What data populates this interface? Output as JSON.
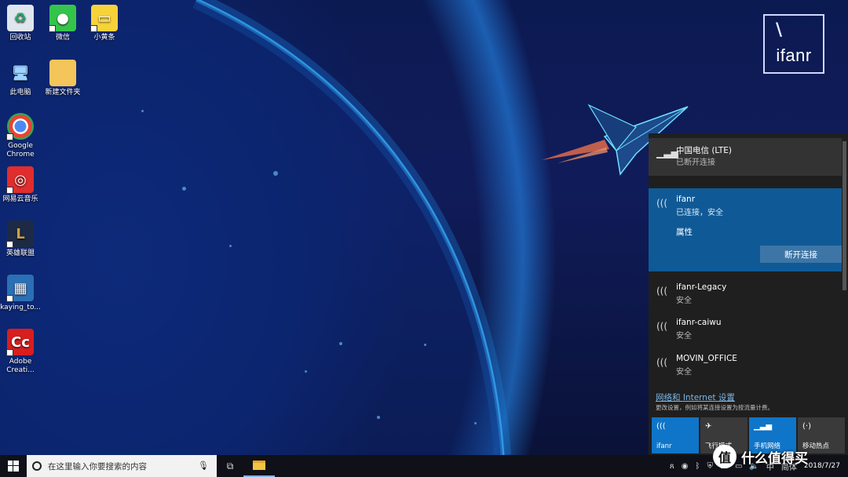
{
  "desktop": {
    "icons": [
      {
        "label": "回收站",
        "icon": "recycle-bin-icon",
        "color": "#dfe6ee"
      },
      {
        "label": "微信",
        "icon": "wechat-icon",
        "color": "#35c44b"
      },
      {
        "label": "小黄条",
        "icon": "sticky-note-icon",
        "color": "#f7d33a"
      },
      {
        "label": "此电脑",
        "icon": "computer-icon",
        "color": "#3a8ee6"
      },
      {
        "label": "新建文件夹",
        "icon": "folder-icon",
        "color": "#f3c55a"
      },
      {
        "label": "Google Chrome",
        "icon": "chrome-icon",
        "color": "#e84435"
      },
      {
        "label": "网易云音乐",
        "icon": "netease-music-icon",
        "color": "#e02d2d"
      },
      {
        "label": "英雄联盟",
        "icon": "league-of-legends-icon",
        "color": "#c8a24a"
      },
      {
        "label": "kaying_to...",
        "icon": "app-icon",
        "color": "#2b6fb5"
      },
      {
        "label": "Adobe Creati...",
        "icon": "adobe-cc-icon",
        "color": "#d81e1e"
      }
    ]
  },
  "logo": {
    "text": "ifanr",
    "mark": "\\"
  },
  "network": {
    "cellular": {
      "name": "中国电信 (LTE)",
      "status": "已断开连接"
    },
    "connected": {
      "name": "ifanr",
      "status": "已连接，安全",
      "properties": "属性",
      "disconnect": "断开连接"
    },
    "others": [
      {
        "name": "ifanr-Legacy",
        "status": "安全"
      },
      {
        "name": "ifanr-caiwu",
        "status": "安全"
      },
      {
        "name": "MOVIN_OFFICE",
        "status": "安全"
      }
    ],
    "settings_link": "网络和 Internet 设置",
    "settings_desc": "更改设置，例如将某连接设置为按流量计费。",
    "tiles": [
      {
        "label": "ifanr",
        "state": "on",
        "icon": "wifi-icon"
      },
      {
        "label": "飞行模式",
        "state": "off",
        "icon": "airplane-icon"
      },
      {
        "label": "手机网络",
        "state": "on",
        "icon": "cellular-icon"
      },
      {
        "label": "移动热点",
        "state": "off",
        "icon": "hotspot-icon"
      }
    ]
  },
  "taskbar": {
    "search_placeholder": "在这里输入你要搜索的内容",
    "ime": "中",
    "ime2": "简体",
    "date": "2018/7/27"
  },
  "watermark": {
    "circle": "值",
    "text": "什么值得买"
  },
  "colors": {
    "accent": "#0f75c8",
    "flyout_bg": "#1f1f1f",
    "selected_bg": "#0f5a96"
  }
}
